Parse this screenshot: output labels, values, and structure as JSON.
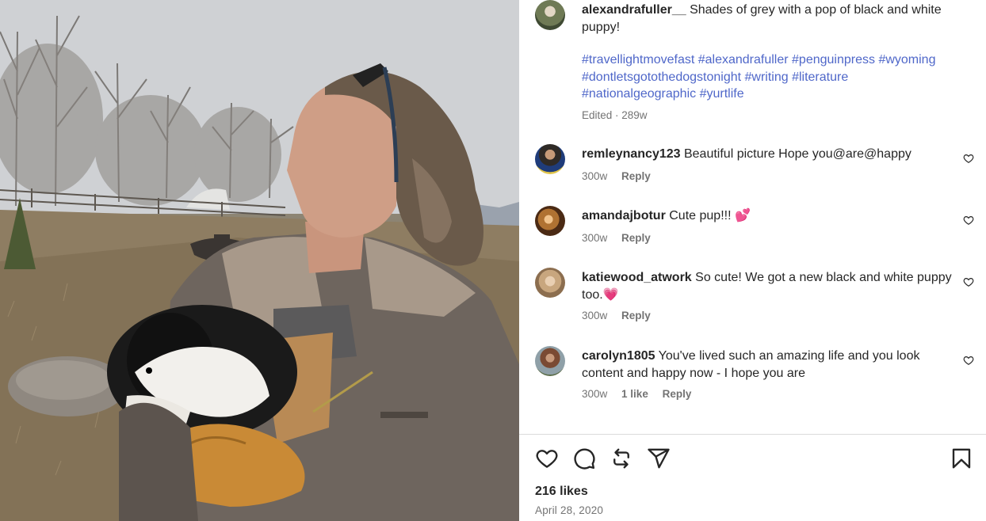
{
  "post": {
    "author": "alexandrafuller__",
    "caption": "Shades of grey with a pop of black and white puppy!",
    "hashtags": "#travellightmovefast #alexandrafuller #penguinpress #wyoming #dontletsgotothedogstonight #writing #literature #nationalgeographic #yurtlife",
    "edited_meta": "Edited · 289w",
    "likes": "216 likes",
    "date": "April 28, 2020"
  },
  "comments": [
    {
      "username": "remleynancy123",
      "text": "Beautiful picture Hope you@are@happy",
      "age": "300w",
      "likes": "",
      "reply": "Reply"
    },
    {
      "username": "amandajbotur",
      "text": "Cute pup!!! 💕",
      "age": "300w",
      "likes": "",
      "reply": "Reply"
    },
    {
      "username": "katiewood_atwork",
      "text": "So cute! We got a new black and white puppy too.💗",
      "age": "300w",
      "likes": "",
      "reply": "Reply"
    },
    {
      "username": "carolyn1805",
      "text": "You've lived such an amazing life and you look content and happy now - I hope you are",
      "age": "300w",
      "likes": "1 like",
      "reply": "Reply"
    }
  ],
  "icons": {
    "like": "heart-icon",
    "comment": "comment-bubble-icon",
    "repost": "repost-icon",
    "share": "send-icon",
    "save": "bookmark-icon"
  },
  "colors": {
    "hashtag": "#4f67c9",
    "text": "#262626",
    "muted": "#737373"
  }
}
